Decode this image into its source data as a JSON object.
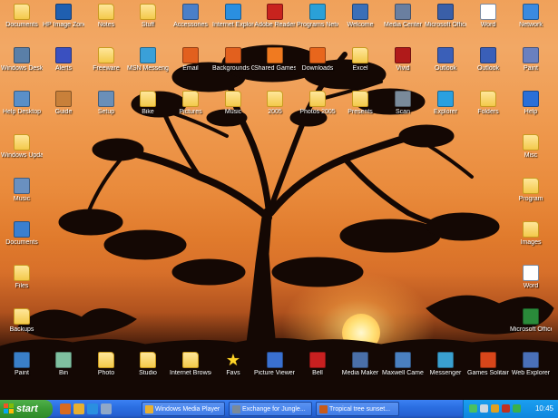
{
  "desktop": {
    "icons": [
      {
        "label": "Documents",
        "kind": "folder"
      },
      {
        "label": "HP Image Zone",
        "kind": "app",
        "color": "#1f5fb0"
      },
      {
        "label": "Notes",
        "kind": "folder"
      },
      {
        "label": "Stuff",
        "kind": "folder"
      },
      {
        "label": "Accessories",
        "kind": "app",
        "color": "#4a7fc9"
      },
      {
        "label": "Internet Explorer",
        "kind": "app",
        "color": "#2a8fe0"
      },
      {
        "label": "Adobe Reader",
        "kind": "app",
        "color": "#c8231e"
      },
      {
        "label": "Programs Network",
        "kind": "app",
        "color": "#2aa0d8"
      },
      {
        "label": "Welcome",
        "kind": "app",
        "color": "#3a6fb8"
      },
      {
        "label": "Media Center",
        "kind": "app",
        "color": "#6a7fa0"
      },
      {
        "label": "Microsoft Office",
        "kind": "app",
        "color": "#3a5fa8"
      },
      {
        "label": "Word",
        "kind": "doc"
      },
      {
        "label": "Network",
        "kind": "app",
        "color": "#3a8ae0"
      },
      {
        "label": "Windows Desktop",
        "kind": "app",
        "color": "#5a7fa8"
      },
      {
        "label": "Alerts",
        "kind": "app",
        "color": "#3a50c0"
      },
      {
        "label": "Freeware",
        "kind": "folder"
      },
      {
        "label": "MSN Messenger",
        "kind": "app",
        "color": "#3aa0d8"
      },
      {
        "label": "Email",
        "kind": "app",
        "color": "#e2601e"
      },
      {
        "label": "Backgrounds Gallery",
        "kind": "app",
        "color": "#e2601e"
      },
      {
        "label": "Shared Games",
        "kind": "app",
        "color": "#f07a20"
      },
      {
        "label": "Downloads",
        "kind": "app",
        "color": "#e8661c"
      },
      {
        "label": "Excel",
        "kind": "folder"
      },
      {
        "label": "Vivid",
        "kind": "app",
        "color": "#b01a1a"
      },
      {
        "label": "Outlook",
        "kind": "app",
        "color": "#3a5fb8"
      },
      {
        "label": "Outlook",
        "kind": "app",
        "color": "#3a5fb8"
      },
      {
        "label": "Paint",
        "kind": "app",
        "color": "#6a80c0"
      },
      {
        "label": "Help Desktop",
        "kind": "app",
        "color": "#5a8fc8"
      },
      {
        "label": "Guide",
        "kind": "app",
        "color": "#c8803a"
      },
      {
        "label": "Setup",
        "kind": "app",
        "color": "#6a8fb8"
      },
      {
        "label": "Bike",
        "kind": "folder"
      },
      {
        "label": "Pictures",
        "kind": "folder"
      },
      {
        "label": "Music",
        "kind": "folder"
      },
      {
        "label": "2005",
        "kind": "folder"
      },
      {
        "label": "Photos 2005",
        "kind": "folder"
      },
      {
        "label": "Presents",
        "kind": "folder"
      },
      {
        "label": "Scan",
        "kind": "app",
        "color": "#7a8a9a"
      },
      {
        "label": "Explorer",
        "kind": "app",
        "color": "#2aa0e0"
      },
      {
        "label": "Folders",
        "kind": "folder"
      },
      {
        "label": "Help",
        "kind": "app",
        "color": "#2a6fd8"
      },
      {
        "label": "Windows Updates",
        "kind": "folder"
      },
      {
        "label": "Misc",
        "kind": "folder"
      },
      {
        "label": "Music",
        "kind": "app",
        "color": "#6a90c0"
      },
      {
        "label": "Program",
        "kind": "folder"
      },
      {
        "label": "Documents",
        "kind": "app",
        "color": "#3a7fd0"
      },
      {
        "label": "Images",
        "kind": "folder"
      },
      {
        "label": "Files",
        "kind": "folder"
      },
      {
        "label": "Word",
        "kind": "doc"
      },
      {
        "label": "Backups",
        "kind": "folder"
      },
      {
        "label": "Microsoft Office Live",
        "kind": "app",
        "color": "#2a8a3a"
      },
      {
        "label": "Paint",
        "kind": "app",
        "color": "#3a7fc8"
      },
      {
        "label": "Bin",
        "kind": "app",
        "color": "#7fc0a0"
      },
      {
        "label": "Photo",
        "kind": "folder"
      },
      {
        "label": "Studio",
        "kind": "folder"
      },
      {
        "label": "Internet Browsers",
        "kind": "folder"
      },
      {
        "label": "Favs",
        "kind": "star"
      },
      {
        "label": "Picture Viewer 2.0",
        "kind": "app",
        "color": "#3a70d0"
      },
      {
        "label": "Bell",
        "kind": "app",
        "color": "#c82020"
      },
      {
        "label": "Media Maker",
        "kind": "app",
        "color": "#4a6fa8"
      },
      {
        "label": "Maxwell Camera",
        "kind": "app",
        "color": "#4a80c0"
      },
      {
        "label": "Messenger",
        "kind": "app",
        "color": "#3aa0d0"
      },
      {
        "label": "Games Solitaire",
        "kind": "app",
        "color": "#d8461a"
      },
      {
        "label": "Web Explorer",
        "kind": "app",
        "color": "#4a70b8"
      }
    ]
  },
  "taskbar": {
    "start_label": "start",
    "quick_launch": [
      {
        "name": "firefox-icon",
        "color": "#d86a1e"
      },
      {
        "name": "media-player-icon",
        "color": "#e8b030"
      },
      {
        "name": "ie-icon",
        "color": "#2a8fe0"
      },
      {
        "name": "show-desktop-icon",
        "color": "#8fa8c8"
      }
    ],
    "tasks": [
      {
        "label": "Windows Media Player",
        "color": "#e8b030"
      },
      {
        "label": "Exchange for Jungle...",
        "color": "#7a8a9a"
      },
      {
        "label": "Tropical tree sunset...",
        "color": "#c85a1a"
      }
    ],
    "tray_icons": [
      {
        "name": "network-tray-icon",
        "color": "#4ac060"
      },
      {
        "name": "volume-tray-icon",
        "color": "#d0d8e0"
      },
      {
        "name": "antivirus-tray-icon",
        "color": "#e0a020"
      },
      {
        "name": "security-tray-icon",
        "color": "#c03020"
      },
      {
        "name": "messenger-tray-icon",
        "color": "#3ab04a"
      }
    ],
    "clock": "10:45"
  },
  "colors": {
    "taskbar_blue": "#2560d2",
    "start_green": "#3a9b34",
    "sky_orange": "#e98a3b"
  }
}
